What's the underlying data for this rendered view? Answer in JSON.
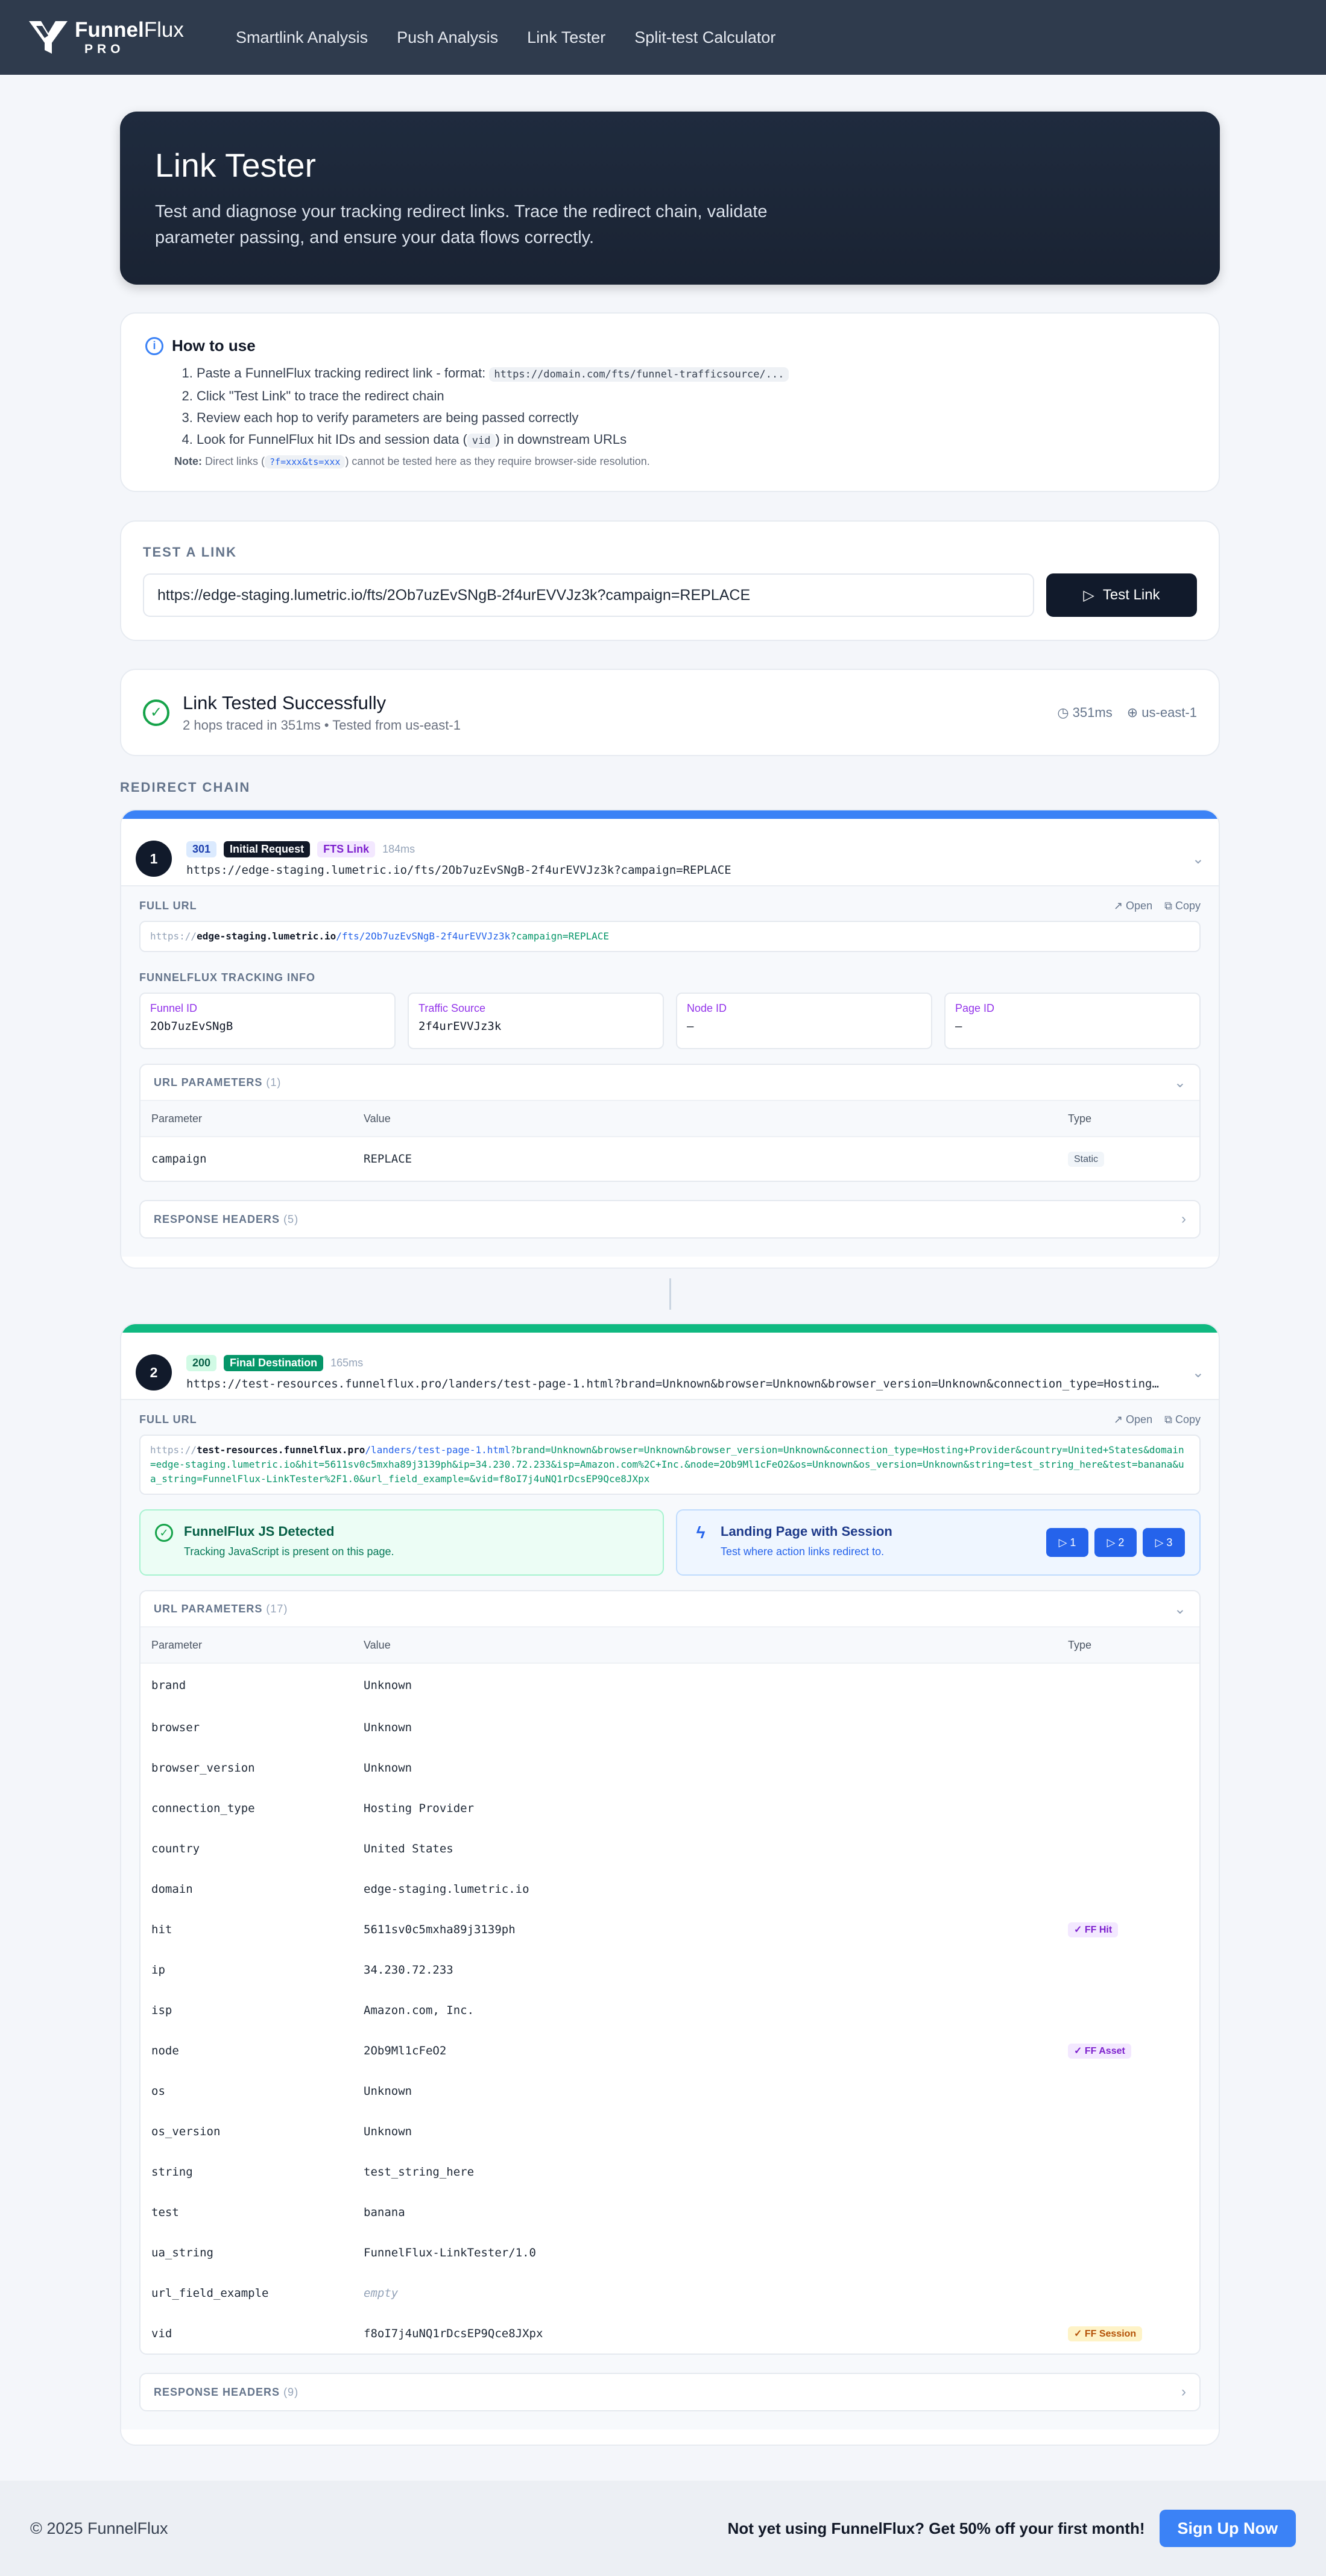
{
  "brand": {
    "name_bold": "Funnel",
    "name_light": "Flux",
    "tier": "PRO"
  },
  "nav": [
    "Smartlink Analysis",
    "Push Analysis",
    "Link Tester",
    "Split-test Calculator"
  ],
  "hero": {
    "title": "Link Tester",
    "subtitle": "Test and diagnose your tracking redirect links. Trace the redirect chain, validate parameter passing, and ensure your data flows correctly."
  },
  "howto": {
    "title": "How to use",
    "steps": [
      {
        "pre": "Paste a FunnelFlux tracking redirect link - format: ",
        "code": "https://domain.com/fts/funnel-trafficsource/...",
        "post": ""
      },
      {
        "pre": "Click \"Test Link\" to trace the redirect chain",
        "code": "",
        "post": ""
      },
      {
        "pre": "Review each hop to verify parameters are being passed correctly",
        "code": "",
        "post": ""
      },
      {
        "pre": "Look for FunnelFlux hit IDs and session data (",
        "code": "vid",
        "post": ") in downstream URLs"
      }
    ],
    "note_label": "Note:",
    "note_pre": "Direct links (",
    "note_code": "?f=xxx&ts=xxx",
    "note_post": ") cannot be tested here as they require browser-side resolution."
  },
  "test": {
    "label": "TEST A LINK",
    "url": "https://edge-staging.lumetric.io/fts/2Ob7uzEvSNgB-2f4urEVVJz3k?campaign=REPLACE",
    "button": "Test Link"
  },
  "result": {
    "title": "Link Tested Successfully",
    "subtitle": "2 hops traced in 351ms • Tested from us-east-1",
    "time": "351ms",
    "region": "us-east-1"
  },
  "chain_label": "REDIRECT CHAIN",
  "hop1": {
    "num": "1",
    "status": "301",
    "type": "Initial Request",
    "tag": "FTS Link",
    "ms": "184ms",
    "url": "https://edge-staging.lumetric.io/fts/2Ob7uzEvSNgB-2f4urEVVJz3k?campaign=REPLACE",
    "full_url_label": "FULL URL",
    "open": "Open",
    "copy": "Copy",
    "url_proto": "https://",
    "url_host": "edge-staging.lumetric.io",
    "url_path": "/fts/2Ob7uzEvSNgB-2f4urEVVJz3k",
    "url_query": "?campaign=REPLACE",
    "tracking_label": "FUNNELFLUX TRACKING INFO",
    "tracking": [
      {
        "k": "Funnel ID",
        "v": "2Ob7uzEvSNgB"
      },
      {
        "k": "Traffic Source",
        "v": "2f4urEVVJz3k"
      },
      {
        "k": "Node ID",
        "v": "—"
      },
      {
        "k": "Page ID",
        "v": "—"
      }
    ],
    "params_label": "URL PARAMETERS",
    "params_count": "(1)",
    "col_param": "Parameter",
    "col_value": "Value",
    "col_type": "Type",
    "params": [
      {
        "p": "campaign",
        "v": "REPLACE",
        "t": "Static"
      }
    ],
    "headers_label": "RESPONSE HEADERS",
    "headers_count": "(5)"
  },
  "hop2": {
    "num": "2",
    "status": "200",
    "type": "Final Destination",
    "ms": "165ms",
    "url": "https://test-resources.funnelflux.pro/landers/test-page-1.html?brand=Unknown&browser=Unknown&browser_version=Unknown&connection_type=Hosting…",
    "full_url_label": "FULL URL",
    "open": "Open",
    "copy": "Copy",
    "url_proto": "https://",
    "url_host": "test-resources.funnelflux.pro",
    "url_path": "/landers/test-page-1.html",
    "url_query": "?brand=Unknown&browser=Unknown&browser_version=Unknown&connection_type=Hosting+Provider&country=United+States&domain=edge-staging.lumetric.io&hit=5611sv0c5mxha89j3139ph&ip=34.230.72.233&isp=Amazon.com%2C+Inc.&node=2Ob9Ml1cFeO2&os=Unknown&os_version=Unknown&string=test_string_here&test=banana&ua_string=FunnelFlux-LinkTester%2F1.0&url_field_example=&vid=f8oI7j4uNQ1rDcsEP9Qce8JXpx",
    "js_title": "FunnelFlux JS Detected",
    "js_sub": "Tracking JavaScript is present on this page.",
    "lp_title": "Landing Page with Session",
    "lp_sub": "Test where action links redirect to.",
    "lp_buttons": [
      "▷ 1",
      "▷ 2",
      "▷ 3"
    ],
    "params_label": "URL PARAMETERS",
    "params_count": "(17)",
    "col_param": "Parameter",
    "col_value": "Value",
    "col_type": "Type",
    "params": [
      {
        "p": "brand",
        "v": "Unknown",
        "t": ""
      },
      {
        "p": "browser",
        "v": "Unknown",
        "t": ""
      },
      {
        "p": "browser_version",
        "v": "Unknown",
        "t": ""
      },
      {
        "p": "connection_type",
        "v": "Hosting Provider",
        "t": ""
      },
      {
        "p": "country",
        "v": "United States",
        "t": ""
      },
      {
        "p": "domain",
        "v": "edge-staging.lumetric.io",
        "t": ""
      },
      {
        "p": "hit",
        "v": "5611sv0c5mxha89j3139ph",
        "t": "✓ FF Hit"
      },
      {
        "p": "ip",
        "v": "34.230.72.233",
        "t": ""
      },
      {
        "p": "isp",
        "v": "Amazon.com, Inc.",
        "t": ""
      },
      {
        "p": "node",
        "v": "2Ob9Ml1cFeO2",
        "t": "✓ FF Asset"
      },
      {
        "p": "os",
        "v": "Unknown",
        "t": ""
      },
      {
        "p": "os_version",
        "v": "Unknown",
        "t": ""
      },
      {
        "p": "string",
        "v": "test_string_here",
        "t": ""
      },
      {
        "p": "test",
        "v": "banana",
        "t": ""
      },
      {
        "p": "ua_string",
        "v": "FunnelFlux-LinkTester/1.0",
        "t": ""
      },
      {
        "p": "url_field_example",
        "v": "empty",
        "t": ""
      },
      {
        "p": "vid",
        "v": "f8oI7j4uNQ1rDcsEP9Qce8JXpx",
        "t": "✓ FF Session"
      }
    ],
    "headers_label": "RESPONSE HEADERS",
    "headers_count": "(9)"
  },
  "footer": {
    "copyright": "© 2025 FunnelFlux",
    "promo": "Not yet using FunnelFlux? Get 50% off your first month!",
    "cta": "Sign Up Now"
  },
  "colors": {
    "hop1_bar": "#3b82f6",
    "hop2_bar": "#10b981",
    "nav_bg": "#2f3b4d"
  }
}
